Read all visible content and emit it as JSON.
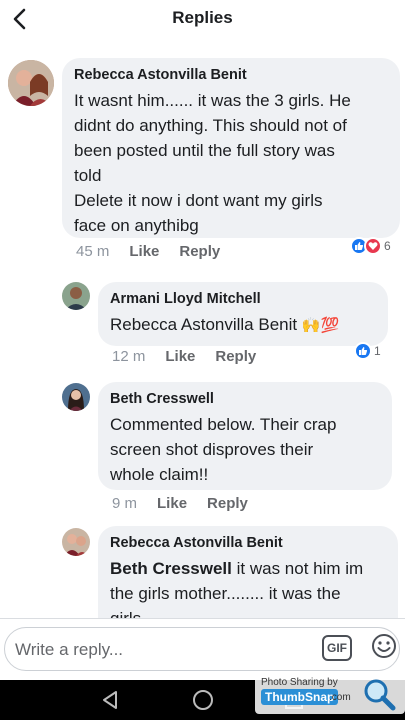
{
  "header": {
    "title": "Replies"
  },
  "comments": [
    {
      "author": "Rebecca Astonvilla Benit",
      "lines": [
        "It wasnt him...... it was the 3 girls. He",
        "didnt do anything. This should not of",
        "been posted until the full story was",
        "told",
        "Delete it now i dont want my girls",
        "face on anythibg"
      ],
      "time": "45 m",
      "like": "Like",
      "reply": "Reply",
      "reaction_count": "6"
    },
    {
      "author": "Armani Lloyd Mitchell",
      "mention": "Rebecca Astonvilla Benit",
      "emoji": "🙌💯",
      "time": "12 m",
      "like": "Like",
      "reply": "Reply",
      "reaction_count": "1"
    },
    {
      "author": "Beth Cresswell",
      "lines": [
        "Commented below. Their crap",
        "screen shot disproves their",
        "whole claim!!"
      ],
      "time": "9 m",
      "like": "Like",
      "reply": "Reply"
    },
    {
      "author": "Rebecca Astonvilla Benit",
      "mention": "Beth Cresswell",
      "line1_rest": " it was not him im",
      "line2": "the girls mother........ it was the",
      "line3": "girls"
    }
  ],
  "composer": {
    "placeholder": "Write a reply...",
    "gif_label": "GIF"
  },
  "watermark": {
    "line1": "Photo Sharing by",
    "brand": "ThumbSnap",
    "suffix": ".com"
  },
  "colors": {
    "like_blue": "#1877f2",
    "love_red": "#e8384f",
    "bubble": "#eff1f4"
  }
}
